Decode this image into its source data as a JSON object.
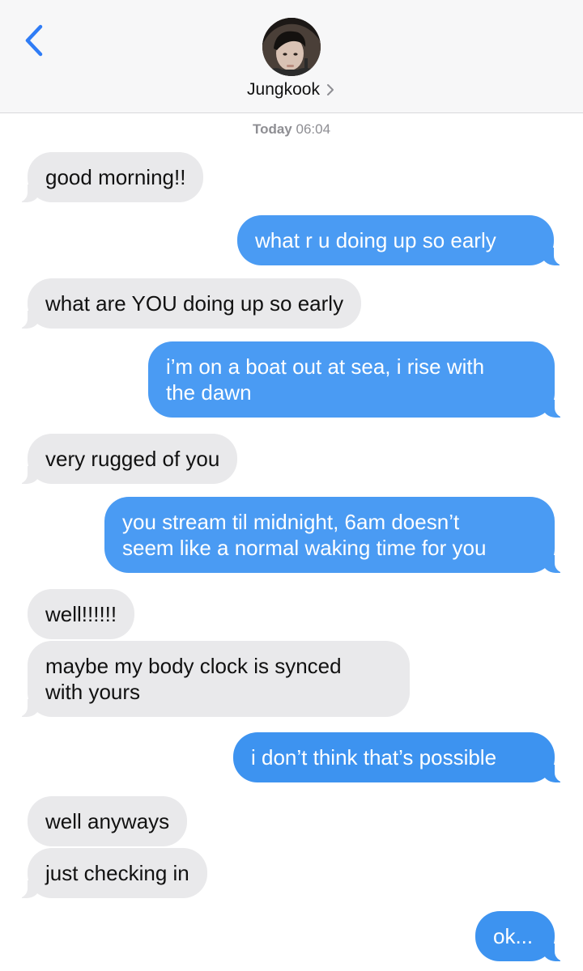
{
  "header": {
    "back_icon": "chevron-left-icon",
    "contact_name": "Jungkook",
    "contact_chevron": ">",
    "accent_color": "#2f7cf6"
  },
  "thread": {
    "timestamp_day": "Today",
    "timestamp_time": "06:04"
  },
  "messages": [
    {
      "direction": "incoming",
      "text": "good morning!!"
    },
    {
      "direction": "outgoing",
      "text": "what r u doing up so early"
    },
    {
      "direction": "incoming",
      "text": "what are YOU doing up so early"
    },
    {
      "direction": "outgoing",
      "line1": "i’m on a boat out at sea, i rise with",
      "line2": "the dawn"
    },
    {
      "direction": "incoming",
      "text": "very rugged of you"
    },
    {
      "direction": "outgoing",
      "line1": "you stream til midnight, 6am doesn’t",
      "line2": "seem like a normal waking time for you"
    },
    {
      "direction": "incoming",
      "text": "well!!!!!!"
    },
    {
      "direction": "incoming",
      "line1": "maybe my body clock is synced",
      "line2": "with yours"
    },
    {
      "direction": "outgoing",
      "text": "i don’t think that’s possible"
    },
    {
      "direction": "incoming",
      "text": "well anyways"
    },
    {
      "direction": "incoming",
      "text": "just checking in"
    },
    {
      "direction": "outgoing",
      "text": "ok..."
    }
  ],
  "colors": {
    "incoming_bubble": "#e9e9eb",
    "outgoing_bubble": "#4a9bf3",
    "header_bg": "#f7f7f8"
  }
}
